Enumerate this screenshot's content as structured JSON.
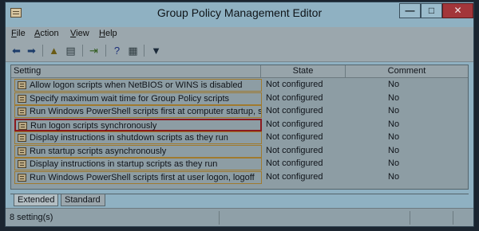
{
  "window": {
    "title": "Group Policy Management Editor"
  },
  "titlebar": {
    "minimize": "—",
    "maximize": "□",
    "close": "✕"
  },
  "menu": [
    {
      "label_rest": "ile",
      "accel": "F"
    },
    {
      "label_rest": "ction",
      "accel": "A"
    },
    {
      "label_rest": "iew",
      "accel": "V"
    },
    {
      "label_rest": "elp",
      "accel": "H"
    }
  ],
  "toolbar": {
    "icons": [
      "back-icon",
      "forward-icon",
      "up-folder-icon",
      "show-hide-tree-icon",
      "export-list-icon",
      "help-icon",
      "properties-icon",
      "filter-icon"
    ],
    "glyphs": [
      "⬅",
      "➡",
      "▲",
      "▤",
      "⇥",
      "?",
      "▦",
      "▼"
    ]
  },
  "table": {
    "columns": [
      "Setting",
      "State",
      "Comment"
    ],
    "rows": [
      {
        "setting": "Allow logon scripts when NetBIOS or WINS is disabled",
        "state": "Not configured",
        "comment": "No"
      },
      {
        "setting": "Specify maximum wait time for Group Policy scripts",
        "state": "Not configured",
        "comment": "No"
      },
      {
        "setting": "Run Windows PowerShell scripts first at computer startup, s...",
        "state": "Not configured",
        "comment": "No"
      },
      {
        "setting": "Run logon scripts synchronously",
        "state": "Not configured",
        "comment": "No",
        "selected": true
      },
      {
        "setting": "Display instructions in shutdown scripts as they run",
        "state": "Not configured",
        "comment": "No"
      },
      {
        "setting": "Run startup scripts asynchronously",
        "state": "Not configured",
        "comment": "No"
      },
      {
        "setting": "Display instructions in startup scripts as they run",
        "state": "Not configured",
        "comment": "No"
      },
      {
        "setting": "Run Windows PowerShell scripts first at user logon, logoff",
        "state": "Not configured",
        "comment": "No"
      }
    ]
  },
  "tabs": [
    "Extended",
    "Standard"
  ],
  "status": {
    "text": "8 setting(s)"
  },
  "colors": {
    "selection_border": "#8b1a1e",
    "row_border": "#a07a2e",
    "close_button": "#a3363a"
  }
}
